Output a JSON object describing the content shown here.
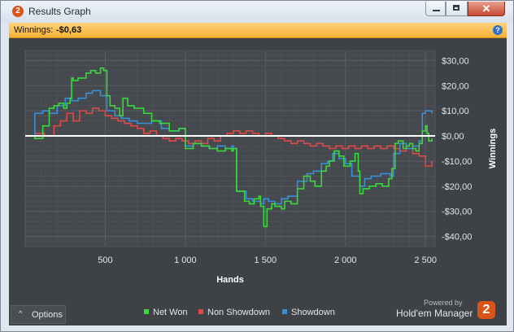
{
  "window": {
    "title": "Results Graph"
  },
  "banner": {
    "label": "Winnings:",
    "value": "-$0,63"
  },
  "chart_data": {
    "type": "line",
    "xlabel": "Hands",
    "ylabel": "Winnings",
    "xlim": [
      0,
      2560
    ],
    "ylim": [
      -44,
      34
    ],
    "x_ticks": [
      500,
      1000,
      1500,
      2000,
      2500
    ],
    "x_tick_labels": [
      "500",
      "1 000",
      "1 500",
      "2 000",
      "2 500"
    ],
    "y_ticks": [
      30,
      20,
      10,
      0,
      -10,
      -20,
      -30,
      -40
    ],
    "y_tick_labels": [
      "$30,00",
      "$20,00",
      "$10,00",
      "$0,00",
      "-$10,00",
      "-$20,00",
      "-$30,00",
      "-$40,00"
    ],
    "grid": true,
    "legend_position": "bottom",
    "series": [
      {
        "name": "Net Won",
        "color": "#39d93c",
        "x": [
          0,
          60,
          110,
          150,
          180,
          210,
          240,
          260,
          280,
          290,
          300,
          330,
          380,
          410,
          440,
          470,
          490,
          510,
          530,
          560,
          590,
          610,
          640,
          680,
          740,
          790,
          840,
          900,
          960,
          1000,
          1050,
          1100,
          1150,
          1200,
          1250,
          1290,
          1300,
          1320,
          1370,
          1400,
          1430,
          1460,
          1470,
          1490,
          1510,
          1540,
          1560,
          1600,
          1620,
          1660,
          1700,
          1740,
          1780,
          1810,
          1850,
          1880,
          1900,
          1930,
          1960,
          1990,
          2030,
          2060,
          2080,
          2090,
          2110,
          2150,
          2190,
          2230,
          2270,
          2290,
          2310,
          2330,
          2360,
          2380,
          2400,
          2420,
          2440,
          2460,
          2480,
          2500,
          2510,
          2520,
          2540
        ],
        "y": [
          0,
          -1,
          4,
          11,
          12,
          13,
          11,
          13,
          15,
          23,
          22,
          23,
          25,
          26,
          25,
          27,
          26,
          16,
          12,
          11,
          8,
          15,
          12,
          11,
          9,
          6,
          5,
          2,
          3,
          -5,
          -3,
          -4,
          -5,
          -6,
          -5,
          -6,
          -5,
          -22,
          -26,
          -27,
          -25,
          -24,
          -28,
          -36,
          -29,
          -27,
          -28,
          -29,
          -26,
          -27,
          -21,
          -16,
          -18,
          -20,
          -14,
          -12,
          -10,
          -6,
          -8,
          -12,
          -10,
          -7,
          -14,
          -23,
          -21,
          -20,
          -19,
          -20,
          -17,
          -13,
          -3,
          -2,
          -5,
          -4,
          -3,
          -5,
          -6,
          -3,
          2,
          4,
          1,
          -2,
          -1
        ]
      },
      {
        "name": "Non Showdown",
        "color": "#e04a46",
        "x": [
          0,
          60,
          120,
          180,
          220,
          260,
          300,
          340,
          380,
          420,
          460,
          500,
          540,
          580,
          620,
          660,
          700,
          740,
          780,
          820,
          860,
          900,
          940,
          980,
          1020,
          1060,
          1100,
          1140,
          1180,
          1220,
          1260,
          1300,
          1340,
          1380,
          1420,
          1460,
          1500,
          1540,
          1580,
          1620,
          1660,
          1700,
          1740,
          1780,
          1820,
          1860,
          1900,
          1940,
          1980,
          2020,
          2060,
          2100,
          2140,
          2180,
          2220,
          2260,
          2300,
          2340,
          2380,
          2420,
          2460,
          2500,
          2540
        ],
        "y": [
          0,
          1,
          0,
          4,
          6,
          9,
          6,
          10,
          9,
          11,
          10,
          8,
          7,
          6,
          5,
          4,
          3,
          1,
          2,
          0,
          -1,
          -2,
          -1,
          -2,
          -3,
          -2,
          -3,
          -1,
          -2,
          0,
          1,
          2,
          1,
          2,
          1,
          0,
          1,
          0,
          -1,
          -2,
          -3,
          -2,
          -3,
          -4,
          -3,
          -4,
          -5,
          -4,
          -5,
          -4,
          -5,
          -4,
          -5,
          -4,
          -5,
          -4,
          -5,
          -6,
          -5,
          -7,
          -8,
          -12,
          -10
        ]
      },
      {
        "name": "Showdown",
        "color": "#3a8fd6",
        "x": [
          0,
          60,
          110,
          150,
          200,
          250,
          290,
          330,
          380,
          420,
          470,
          510,
          560,
          600,
          650,
          700,
          740,
          790,
          850,
          900,
          960,
          1000,
          1050,
          1100,
          1150,
          1200,
          1250,
          1290,
          1300,
          1320,
          1380,
          1420,
          1470,
          1490,
          1520,
          1560,
          1600,
          1640,
          1700,
          1760,
          1800,
          1850,
          1890,
          1920,
          1960,
          2000,
          2040,
          2090,
          2120,
          2160,
          2220,
          2280,
          2300,
          2340,
          2380,
          2420,
          2460,
          2480,
          2500,
          2540
        ],
        "y": [
          0,
          9,
          10,
          9,
          12,
          15,
          14,
          15,
          17,
          18,
          16,
          10,
          8,
          7,
          6,
          5,
          5,
          6,
          3,
          2,
          3,
          -4,
          -3,
          -4,
          -5,
          -4,
          -5,
          -4,
          -5,
          -22,
          -25,
          -26,
          -27,
          -25,
          -26,
          -27,
          -25,
          -24,
          -18,
          -15,
          -14,
          -11,
          -10,
          -7,
          -9,
          -11,
          -16,
          -20,
          -17,
          -16,
          -15,
          -16,
          -7,
          -3,
          -5,
          -4,
          -2,
          9,
          10,
          9
        ]
      }
    ]
  },
  "footer": {
    "options_label": "Options",
    "powered_by": "Powered by",
    "brand_name": "Hold'em Manager",
    "brand_logo": "2"
  }
}
